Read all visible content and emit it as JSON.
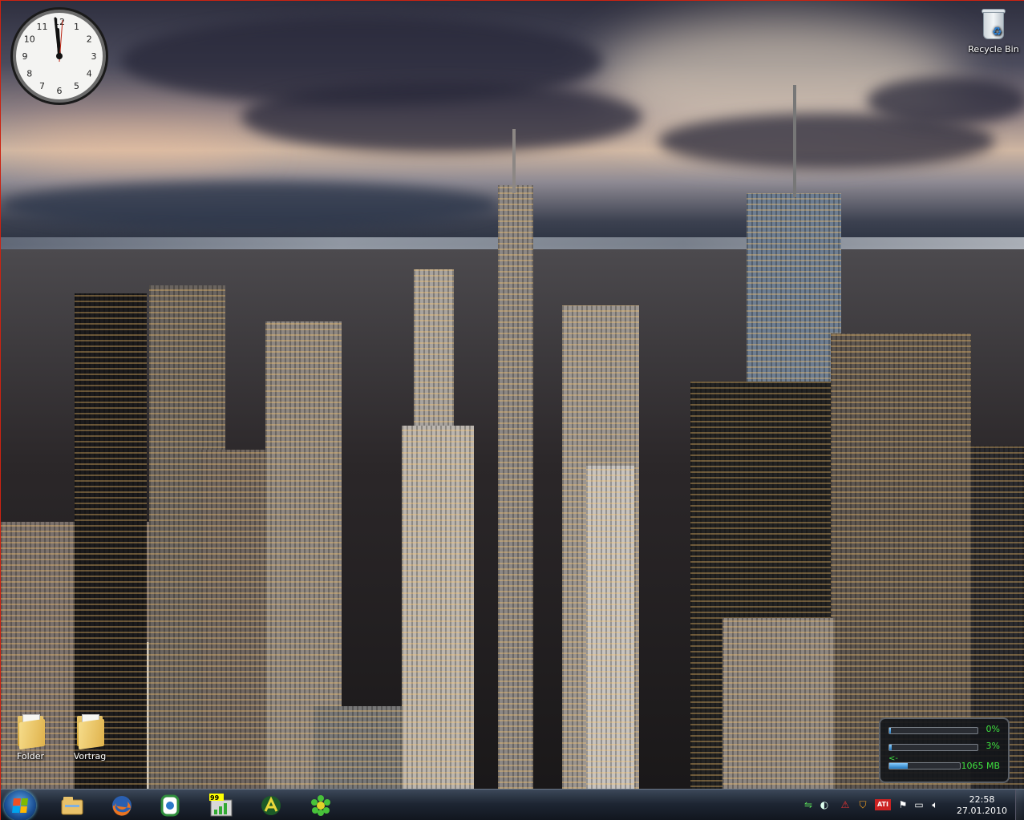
{
  "desktop": {
    "icons": [
      {
        "label": "Recycle Bin",
        "icon": "recycle-bin-icon"
      },
      {
        "label": "Folder",
        "icon": "folder-icon"
      },
      {
        "label": "Vortrag",
        "icon": "folder-icon"
      }
    ]
  },
  "clock_gadget": {
    "numbers": [
      "12",
      "1",
      "2",
      "3",
      "4",
      "5",
      "6",
      "7",
      "8",
      "9",
      "10",
      "11"
    ],
    "time_shown": "11:58"
  },
  "meter_gadget": {
    "rows": [
      {
        "value": "0%",
        "fill": 0.02
      },
      {
        "value": "3%",
        "fill": 0.03
      },
      {
        "value": "1065 MB",
        "fill": 0.26
      }
    ],
    "accent": "#3fe13f"
  },
  "taskbar": {
    "start_icon": "windows-logo-icon",
    "pinned": [
      "explorer-icon",
      "firefox-icon",
      "app-icon",
      "stats-icon",
      "antivirus-icon",
      "icq-icon"
    ],
    "pinned_badge": "99",
    "tray_icons": [
      "network-icon",
      "antivirus-tray-icon",
      "shield-tray-icon",
      "ati-icon",
      "flag-icon",
      "display-icon",
      "volume-icon"
    ],
    "tray_ati_text": "ATI",
    "time": "22:58",
    "date": "27.01.2010"
  },
  "colors": {
    "accent": "#2d7fd1",
    "taskbar": "#1e2633"
  }
}
